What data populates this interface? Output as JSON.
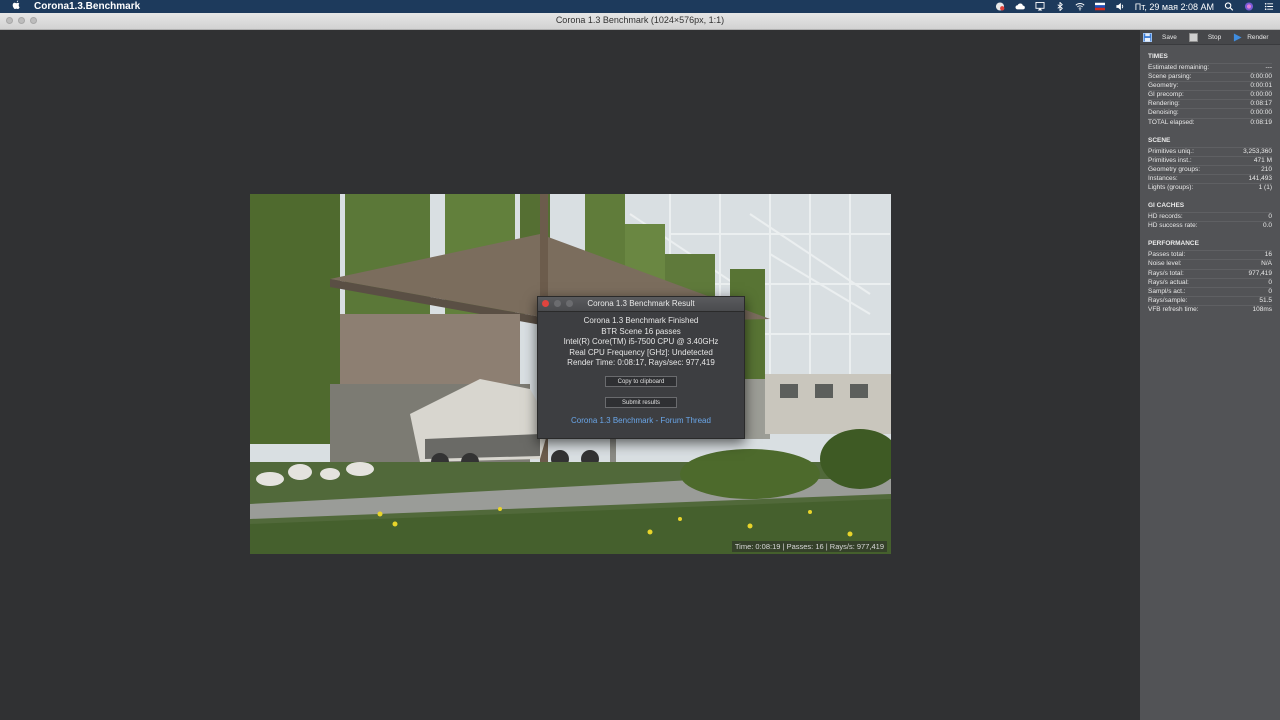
{
  "menubar": {
    "app_name": "Corona1.3.Benchmark",
    "datetime": "Пт, 29 мая  2:08 AM"
  },
  "window": {
    "title": "Corona 1.3 Benchmark (1024×576px, 1:1)"
  },
  "render": {
    "status": "Time: 0:08:19 | Passes: 16 | Rays/s: 977,419"
  },
  "dialog": {
    "title": "Corona 1.3 Benchmark Result",
    "lines": [
      "Corona 1.3 Benchmark Finished",
      "BTR Scene 16 passes",
      "Intel(R) Core(TM) i5-7500 CPU @ 3.40GHz",
      "Real CPU Frequency [GHz]: Undetected",
      "Render Time: 0:08:17, Rays/sec: 977,419"
    ],
    "copy_button": "Copy to clipboard",
    "submit_button": "Submit results",
    "forum_link": "Corona 1.3 Benchmark - Forum Thread"
  },
  "toolbar": {
    "save": "Save",
    "stop": "Stop",
    "render": "Render"
  },
  "panel": {
    "times": {
      "title": "TIMES",
      "rows": [
        {
          "label": "Estimated remaining:",
          "value": "---"
        },
        {
          "label": "Scene parsing:",
          "value": "0:00:00"
        },
        {
          "label": "Geometry:",
          "value": "0:00:01"
        },
        {
          "label": "GI precomp:",
          "value": "0:00:00"
        },
        {
          "label": "Rendering:",
          "value": "0:08:17"
        },
        {
          "label": "Denoising:",
          "value": "0:00:00"
        },
        {
          "label": "TOTAL elapsed:",
          "value": "0:08:19"
        }
      ]
    },
    "scene": {
      "title": "SCENE",
      "rows": [
        {
          "label": "Primitives uniq.:",
          "value": "3,253,360"
        },
        {
          "label": "Primitives inst.:",
          "value": "471 M"
        },
        {
          "label": "Geometry groups:",
          "value": "210"
        },
        {
          "label": "Instances:",
          "value": "141,493"
        },
        {
          "label": "Lights (groups):",
          "value": "1 (1)"
        }
      ]
    },
    "gi": {
      "title": "GI CACHES",
      "rows": [
        {
          "label": "HD records:",
          "value": "0"
        },
        {
          "label": "HD success rate:",
          "value": "0.0"
        }
      ]
    },
    "perf": {
      "title": "PERFORMANCE",
      "rows": [
        {
          "label": "Passes total:",
          "value": "16"
        },
        {
          "label": "Noise level:",
          "value": "N/A"
        },
        {
          "label": "Rays/s total:",
          "value": "977,419"
        },
        {
          "label": "Rays/s actual:",
          "value": "0"
        },
        {
          "label": "Sampl/s act.:",
          "value": "0"
        },
        {
          "label": "Rays/sample:",
          "value": "51.5"
        },
        {
          "label": "VFB refresh time:",
          "value": "108ms"
        }
      ]
    }
  }
}
